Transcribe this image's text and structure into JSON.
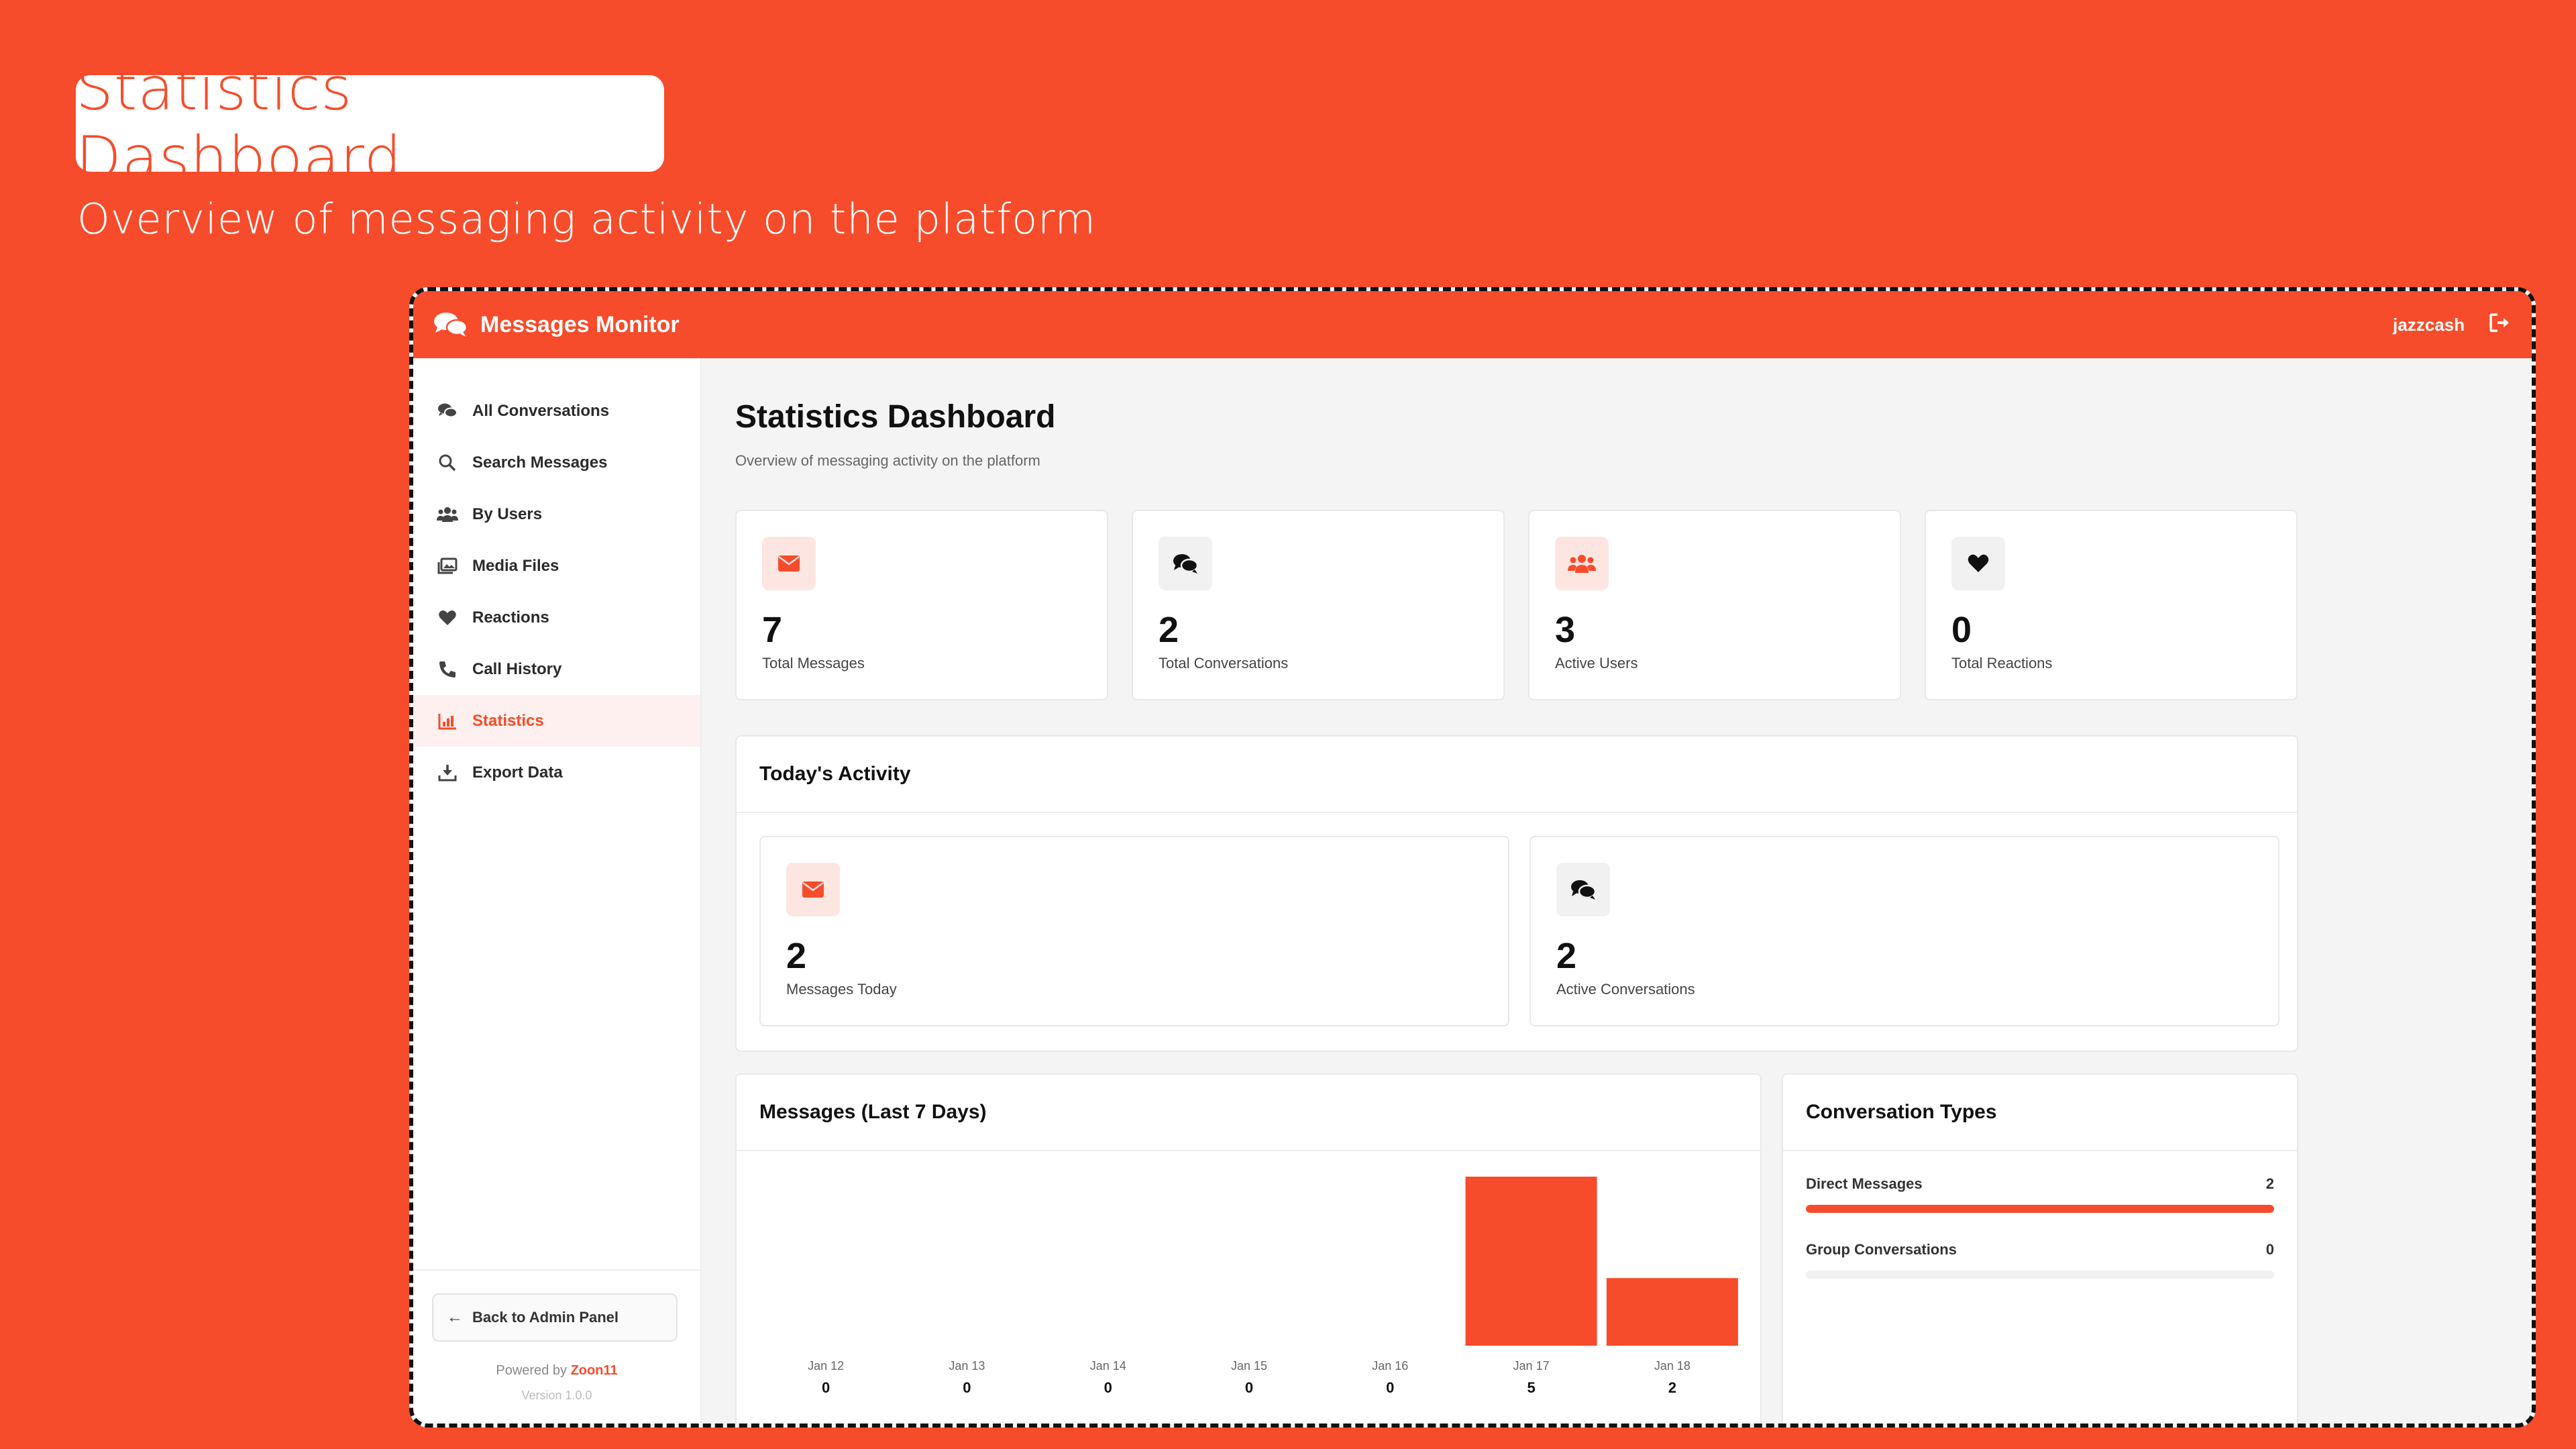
{
  "hero": {
    "title": "Statistics Dashboard",
    "subtitle": "Overview of messaging activity on the platform"
  },
  "topbar": {
    "brand": "Messages Monitor",
    "username": "jazzcash"
  },
  "sidebar": {
    "items": [
      {
        "label": "All Conversations",
        "icon": "chat-bubbles-icon"
      },
      {
        "label": "Search Messages",
        "icon": "search-icon"
      },
      {
        "label": "By Users",
        "icon": "users-icon"
      },
      {
        "label": "Media Files",
        "icon": "images-icon"
      },
      {
        "label": "Reactions",
        "icon": "heart-icon"
      },
      {
        "label": "Call History",
        "icon": "phone-icon"
      },
      {
        "label": "Statistics",
        "icon": "chart-icon"
      },
      {
        "label": "Export Data",
        "icon": "download-icon"
      }
    ],
    "active_index": 6,
    "back_label": "Back to Admin Panel",
    "powered_prefix": "Powered by",
    "powered_brand": "Zoon11",
    "version": "Version 1.0.0"
  },
  "main": {
    "title": "Statistics Dashboard",
    "subtitle": "Overview of messaging activity on the platform",
    "stats": [
      {
        "value": "7",
        "label": "Total Messages",
        "icon": "envelope-icon"
      },
      {
        "value": "2",
        "label": "Total Conversations",
        "icon": "chat-bubbles-icon"
      },
      {
        "value": "3",
        "label": "Active Users",
        "icon": "users-icon"
      },
      {
        "value": "0",
        "label": "Total Reactions",
        "icon": "heart-icon"
      }
    ],
    "today": {
      "title": "Today's Activity",
      "items": [
        {
          "value": "2",
          "label": "Messages Today",
          "icon": "envelope-icon"
        },
        {
          "value": "2",
          "label": "Active Conversations",
          "icon": "chat-bubbles-icon"
        }
      ]
    },
    "messages_chart_title": "Messages (Last 7 Days)",
    "conversation_types": {
      "title": "Conversation Types",
      "items": [
        {
          "label": "Direct Messages",
          "value": "2",
          "fraction": 1.0
        },
        {
          "label": "Group Conversations",
          "value": "0",
          "fraction": 0.0
        }
      ]
    }
  },
  "colors": {
    "accent": "#F64C2B",
    "accent_light": "#FDE6E1"
  },
  "chart_data": {
    "type": "bar",
    "title": "Messages (Last 7 Days)",
    "categories": [
      "Jan 12",
      "Jan 13",
      "Jan 14",
      "Jan 15",
      "Jan 16",
      "Jan 17",
      "Jan 18"
    ],
    "values": [
      0,
      0,
      0,
      0,
      0,
      5,
      2
    ],
    "ylim": [
      0,
      5
    ],
    "grid": false
  }
}
